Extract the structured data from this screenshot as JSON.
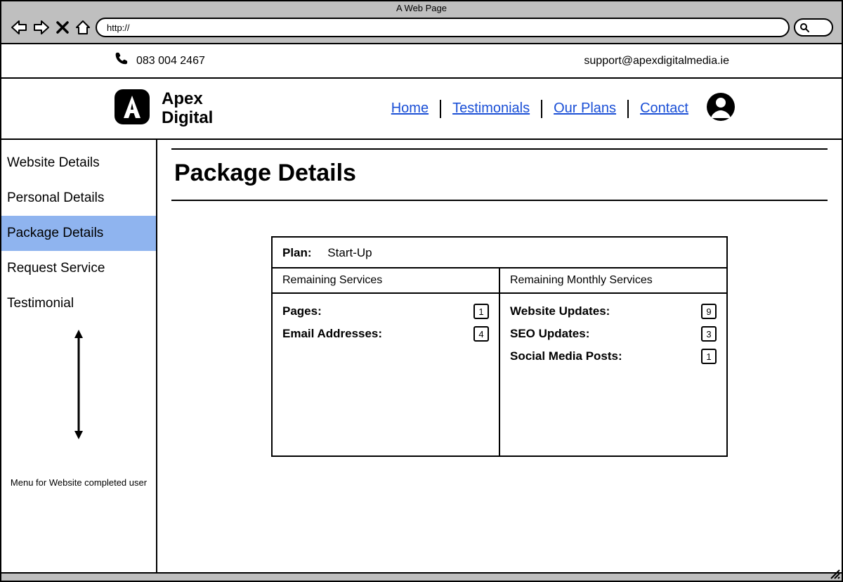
{
  "browser": {
    "title": "A Web Page",
    "url": "http://"
  },
  "contact": {
    "phone": "083 004 2467",
    "email": "support@apexdigitalmedia.ie"
  },
  "brand": {
    "line1": "Apex",
    "line2": "Digital"
  },
  "nav": {
    "home": "Home",
    "testimonials": "Testimonials",
    "plans": "Our Plans",
    "contact": "Contact"
  },
  "sidebar": {
    "items": [
      {
        "label": "Website Details"
      },
      {
        "label": "Personal Details"
      },
      {
        "label": "Package Details"
      },
      {
        "label": "Request Service"
      },
      {
        "label": "Testimonial"
      }
    ],
    "note": "Menu for Website completed user"
  },
  "page": {
    "title": "Package Details",
    "plan_label": "Plan:",
    "plan_value": "Start-Up",
    "col1_header": "Remaining Services",
    "col2_header": "Remaining Monthly Services",
    "remaining": {
      "pages_label": "Pages:",
      "pages_value": "1",
      "emails_label": "Email Addresses:",
      "emails_value": "4"
    },
    "monthly": {
      "updates_label": "Website Updates:",
      "updates_value": "9",
      "seo_label": "SEO Updates:",
      "seo_value": "3",
      "social_label": "Social Media Posts:",
      "social_value": "1"
    }
  }
}
